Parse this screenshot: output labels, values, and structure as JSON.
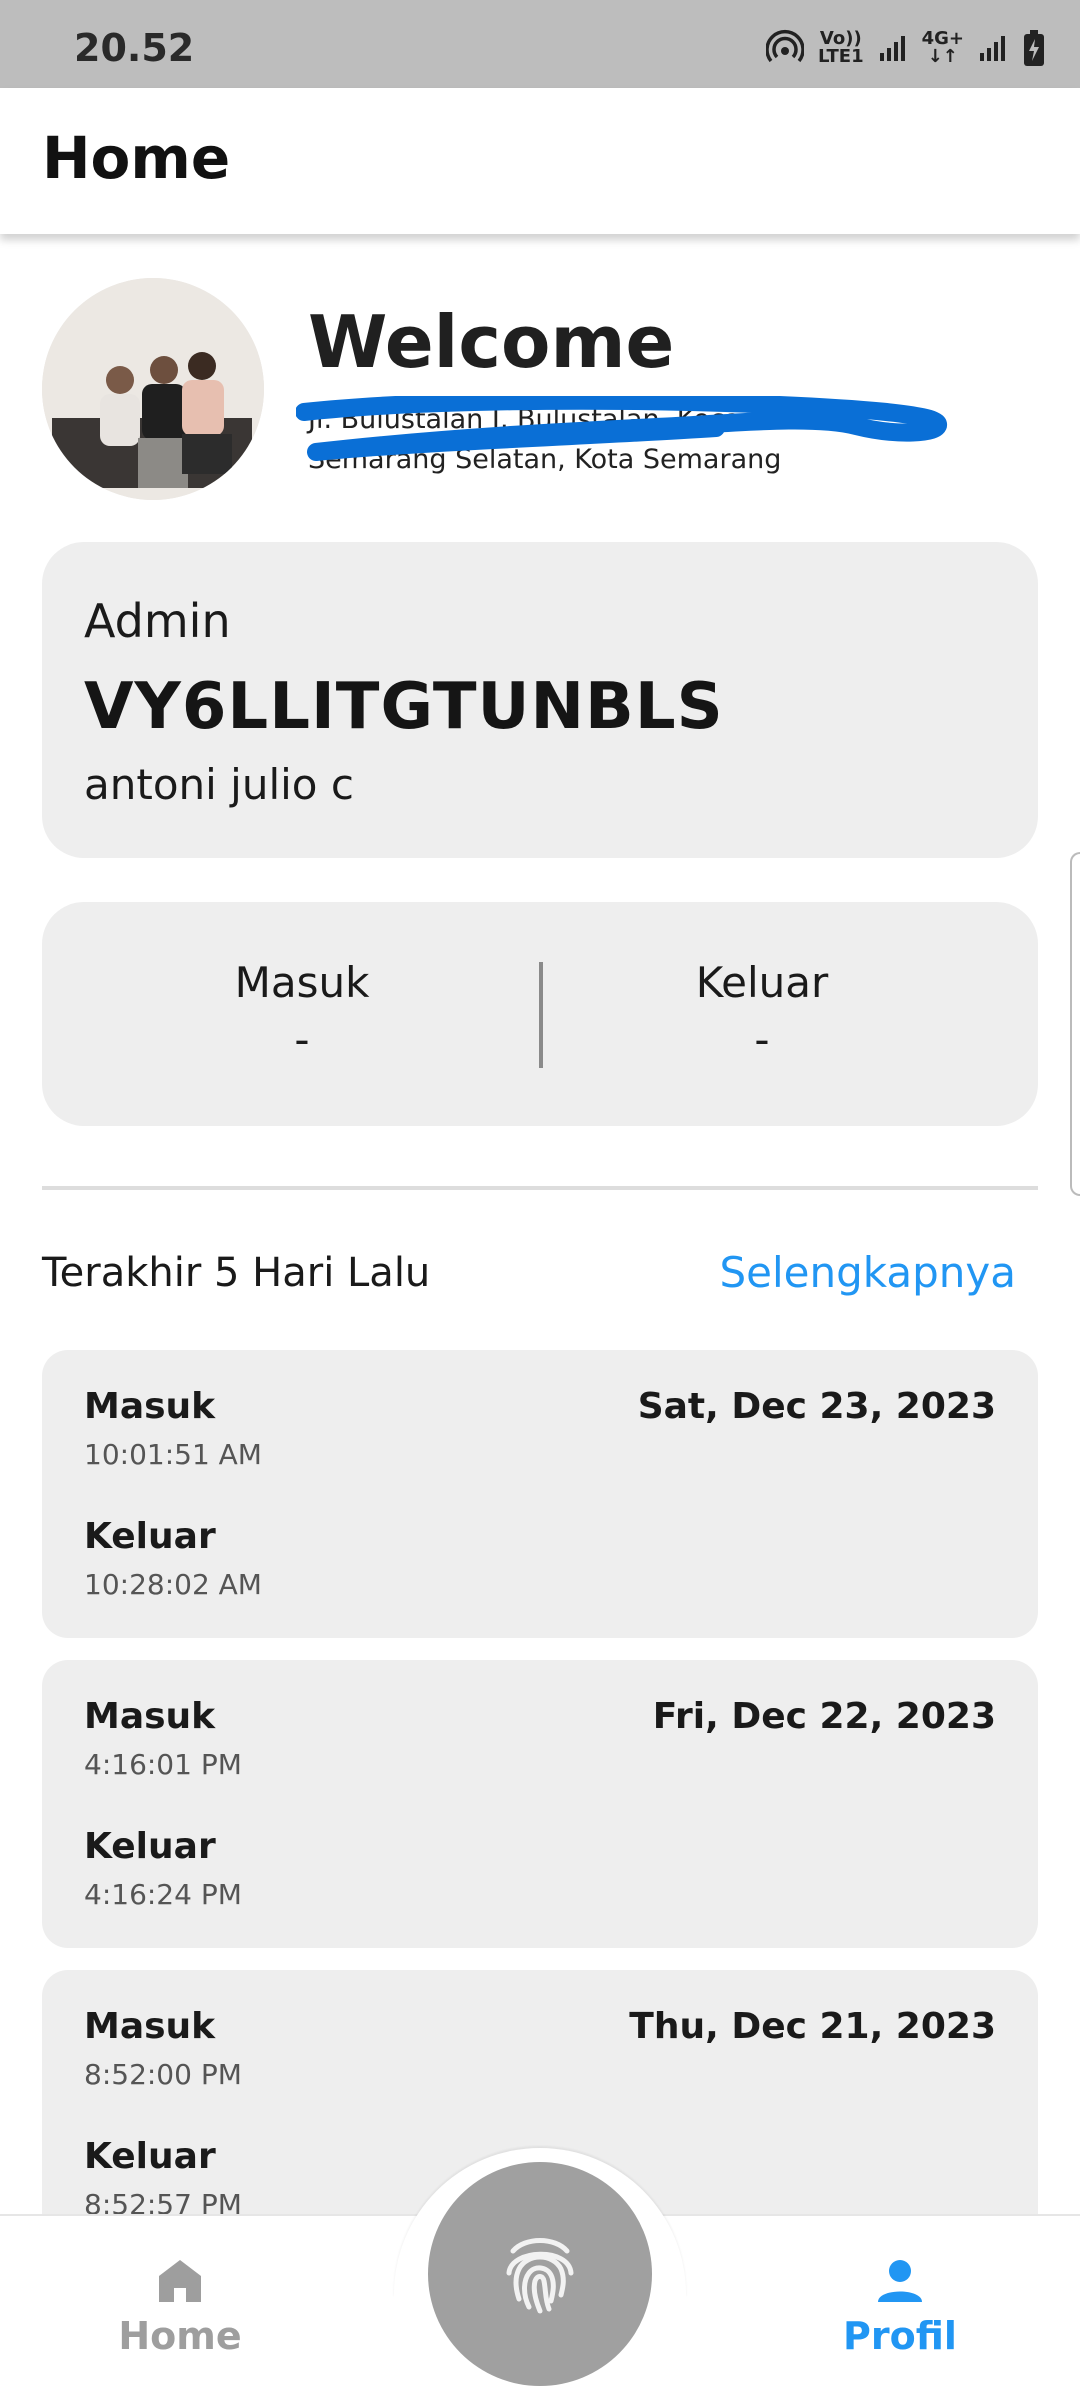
{
  "status_bar": {
    "time": "20.52",
    "volte_top": "Vo))",
    "volte_bottom": "LTE1",
    "net_top": "4G+",
    "net_bottom": "↓↑"
  },
  "app_bar": {
    "title": "Home"
  },
  "welcome": {
    "heading": "Welcome",
    "address_line1": "Jl. Bulustalan I, Bulustalan, Kecamatan",
    "address_line2": "Semarang Selatan, Kota Semarang"
  },
  "admin_card": {
    "role": "Admin",
    "code": "VY6LLITGTUNBLS",
    "name": "antoni julio c"
  },
  "today": {
    "in_label": "Masuk",
    "in_value": "-",
    "out_label": "Keluar",
    "out_value": "-"
  },
  "history": {
    "title": "Terakhir 5 Hari Lalu",
    "more_link": "Selengkapnya",
    "items": [
      {
        "in_label": "Masuk",
        "in_time": "10:01:51 AM",
        "out_label": "Keluar",
        "out_time": "10:28:02 AM",
        "date": "Sat, Dec 23, 2023"
      },
      {
        "in_label": "Masuk",
        "in_time": "4:16:01 PM",
        "out_label": "Keluar",
        "out_time": "4:16:24 PM",
        "date": "Fri, Dec 22, 2023"
      },
      {
        "in_label": "Masuk",
        "in_time": "8:52:00 PM",
        "out_label": "Keluar",
        "out_time": "8:52:57 PM",
        "date": "Thu, Dec 21, 2023"
      }
    ]
  },
  "bottom_nav": {
    "home_label": "Home",
    "profil_label": "Profil"
  },
  "colors": {
    "accent": "#2196f3",
    "card_bg": "#eeeeee",
    "fab_bg": "#a0a0a0",
    "redaction": "#0a6fd6"
  }
}
